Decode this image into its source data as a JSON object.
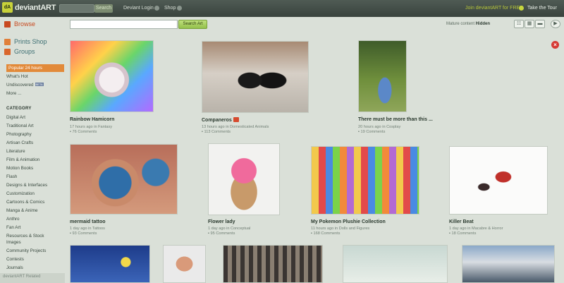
{
  "topbar": {
    "logo_badge": "dA",
    "logo_text": "deviantART",
    "search_button": "Search",
    "deviant_login": "Deviant Login",
    "shop": "Shop",
    "join": "Join deviantART for FREE",
    "tour": "Take the Tour"
  },
  "search": {
    "button": "Search Art",
    "mature_label": "Mature content",
    "mature_value": "Hidden"
  },
  "sidebar": {
    "browse": "Browse",
    "prints_shop": "Prints Shop",
    "groups": "Groups",
    "popular": "Popular 24 hours",
    "whats_hot": "What's Hot",
    "undiscovered": "Undiscovered",
    "beta": "BETA",
    "more": "More ...",
    "category_heading": "CATEGORY",
    "categories": [
      "Digital Art",
      "Traditional Art",
      "Photography",
      "Artisan Crafts",
      "Literature",
      "Film & Animation",
      "Motion Books",
      "Flash",
      "Designs & Interfaces",
      "Customization",
      "Cartoons & Comics",
      "Manga & Anime",
      "Anthro",
      "Fan Art",
      "Resources & Stock",
      "Images",
      "Community Projects",
      "Contests",
      "Journals"
    ],
    "footer": "deviantART Related"
  },
  "tiles": [
    {
      "title": "Rainbow Hamicorn",
      "meta": "17 hours ago in Fantasy",
      "comments": "76 Comments"
    },
    {
      "title": "Companeros",
      "meta": "13 hours ago in Domesticated Animals",
      "comments": "113 Comments"
    },
    {
      "title": "There must be more than this ...",
      "meta": "20 hours ago in Cosplay",
      "comments": "19 Comments"
    },
    {
      "title": "mermaid tattoo",
      "meta": "1 day ago in Tattoos",
      "comments": "93 Comments"
    },
    {
      "title": "Flower lady",
      "meta": "1 day ago in Conceptual",
      "comments": "95 Comments"
    },
    {
      "title": "My Pokemon Plushie Collection",
      "meta": "11 hours ago in Dolls and Figures",
      "comments": "168 Comments"
    },
    {
      "title": "Killer Beat",
      "meta": "1 day ago in Macabre & Horror",
      "comments": "18 Comments"
    }
  ]
}
